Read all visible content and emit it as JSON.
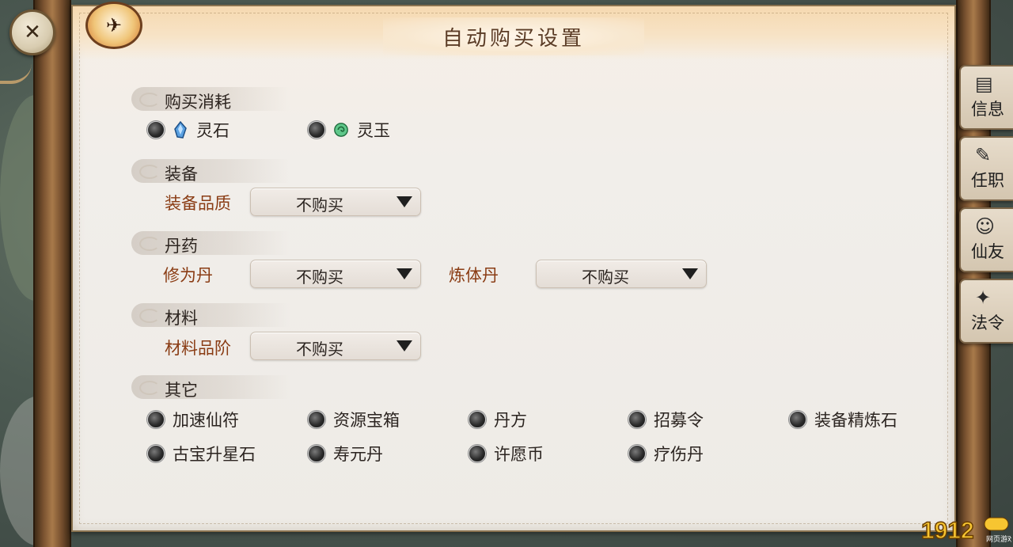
{
  "dialog": {
    "title": "自动购买设置"
  },
  "sections": {
    "purchase_cost": {
      "header": "购买消耗",
      "options": [
        {
          "label": "灵石",
          "icon": "spirit-stone-icon"
        },
        {
          "label": "灵玉",
          "icon": "spirit-jade-icon"
        }
      ]
    },
    "equipment": {
      "header": "装备",
      "rows": [
        {
          "label": "装备品质",
          "value": "不购买"
        }
      ]
    },
    "pills": {
      "header": "丹药",
      "rows": [
        {
          "label": "修为丹",
          "value": "不购买"
        },
        {
          "label": "炼体丹",
          "value": "不购买"
        }
      ]
    },
    "materials": {
      "header": "材料",
      "rows": [
        {
          "label": "材料品阶",
          "value": "不购买"
        }
      ]
    },
    "other": {
      "header": "其它",
      "items": [
        "加速仙符",
        "资源宝箱",
        "丹方",
        "招募令",
        "装备精炼石",
        "古宝升星石",
        "寿元丹",
        "许愿币",
        "疗伤丹"
      ]
    }
  },
  "side_tabs": [
    {
      "label": "信息",
      "icon": "scroll-icon"
    },
    {
      "label": "任职",
      "icon": "badge-icon"
    },
    {
      "label": "仙友",
      "icon": "friend-icon"
    },
    {
      "label": "法令",
      "icon": "decree-icon"
    }
  ],
  "watermark": {
    "text": "1912",
    "subtext": "网页游戏"
  },
  "colors": {
    "row_label": "#8a3c14",
    "title": "#5b3c26",
    "panel": "#f1eeea"
  }
}
